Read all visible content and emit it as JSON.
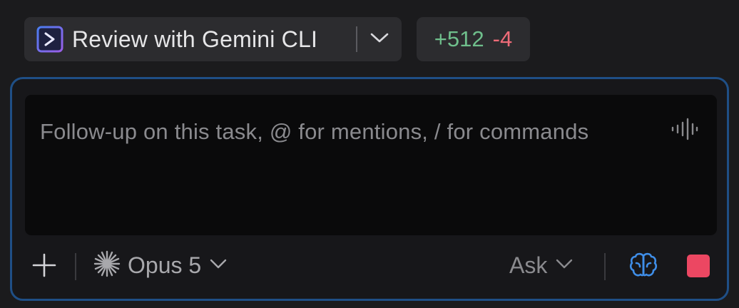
{
  "review": {
    "label": "Review with Gemini CLI",
    "icon": "gemini-cli-icon",
    "caret_icon": "chevron-down-icon"
  },
  "diff": {
    "added": "+512",
    "removed": "-4"
  },
  "composer": {
    "placeholder": "Follow-up on this task, @ for mentions, / for commands",
    "mic_icon": "voice-waveform-icon",
    "add_icon": "plus-icon",
    "model": {
      "icon": "sparkle-icon",
      "label": "Opus 5"
    },
    "mode": {
      "label": "Ask"
    },
    "brain_icon": "brain-icon",
    "stop_icon": "stop-icon"
  },
  "colors": {
    "accent_border": "#1f4f86",
    "added": "#6fbf8c",
    "removed": "#ee6b78",
    "stop": "#ec4762",
    "brain": "#3f8ee8",
    "gemini_icon": "#6d6cf0"
  }
}
